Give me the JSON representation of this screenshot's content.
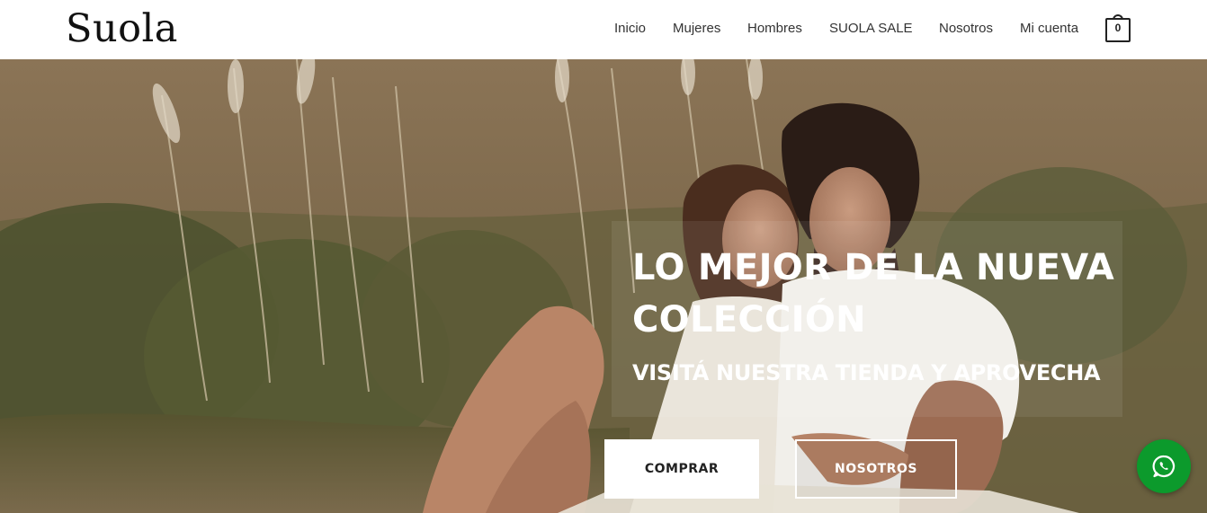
{
  "header": {
    "logo": "Suola",
    "nav": [
      {
        "label": "Inicio"
      },
      {
        "label": "Mujeres"
      },
      {
        "label": "Hombres"
      },
      {
        "label": "SUOLA SALE"
      },
      {
        "label": "Nosotros"
      },
      {
        "label": "Mi cuenta"
      }
    ],
    "cart_count": "0",
    "cart_icon": "shopping-bag-icon"
  },
  "hero": {
    "title": "LO MEJOR DE LA NUEVA COLECCIÓN",
    "subtitle": "VISITÁ NUESTRA TIENDA Y APROVECHA",
    "primary_button": "COMPRAR",
    "secondary_button": "NOSOTROS"
  },
  "floating": {
    "whatsapp_icon": "whatsapp-icon",
    "whatsapp_color": "#0c9a2c"
  }
}
